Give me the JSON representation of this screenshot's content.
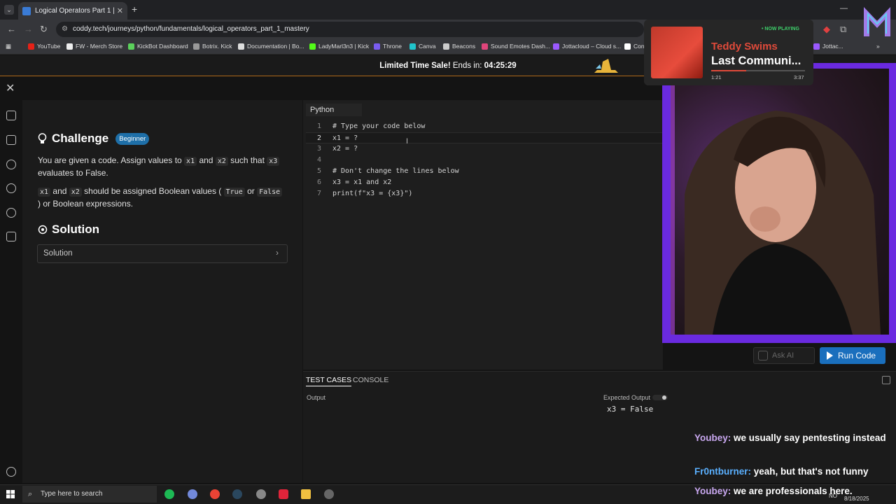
{
  "browser": {
    "tab_title": "Logical Operators Part 1 | Pytho",
    "url": "coddy.tech/journeys/python/fundamentals/logical_operators_part_1_mastery",
    "bookmarks": [
      "YouTube",
      "FW - Merch Store",
      "KickBot Dashboard",
      "Botrix. Kick",
      "Documentation | Bo...",
      "LadyMarl3n3 | Kick",
      "Throne",
      "Canva",
      "Beacons",
      "Sound Emotes Dash...",
      "Jottacloud – Cloud s...",
      "Con",
      "Jottac..."
    ]
  },
  "promo": {
    "text": "Limited Time Sale!",
    "ends_label": "Ends in:",
    "countdown": "04:25:29"
  },
  "challenge": {
    "title": "Challenge",
    "badge": "Beginner",
    "p1_a": "You are given a code. Assign values to",
    "p1_code1": "x1",
    "p1_and": "and",
    "p1_code2": "x2",
    "p1_b": "such that",
    "p1_code3": "x3",
    "p1_c": "evaluates to False.",
    "p2_code1": "x1",
    "p2_and": "and",
    "p2_code2": "x2",
    "p2_a": "should be assigned Boolean values (",
    "p2_true": "True",
    "p2_or": "or",
    "p2_false": "False",
    "p2_b": ") or Boolean expressions."
  },
  "solution": {
    "title": "Solution",
    "button": "Solution"
  },
  "editor": {
    "language": "Python",
    "lines": [
      {
        "num": "1",
        "code": "# Type your code below"
      },
      {
        "num": "2",
        "code": "x1 = ?"
      },
      {
        "num": "3",
        "code": "x2 = ?"
      },
      {
        "num": "4",
        "code": ""
      },
      {
        "num": "5",
        "code": "# Don't change the lines below"
      },
      {
        "num": "6",
        "code": "x3 = x1 and x2"
      },
      {
        "num": "7",
        "code": "print(f\"x3 = {x3}\")"
      }
    ]
  },
  "actions": {
    "ask_ai": "Ask AI",
    "run_code": "Run Code"
  },
  "bottom": {
    "tabs": [
      "TEST CASES",
      "CONSOLE"
    ],
    "output_label": "Output",
    "expected_label": "Expected Output",
    "expected_value": "x3 = False"
  },
  "now_playing": {
    "badge": "• NOW PLAYING",
    "artist": "Teddy Swims",
    "track": "Last Communi...",
    "elapsed": "1:21",
    "duration": "3:37",
    "progress_fraction": 0.37,
    "accent": "#e04a3a"
  },
  "chat": [
    {
      "user": "Youbey:",
      "msg": "we usually say pentesting instead"
    },
    {
      "user": "Fr0ntburner:",
      "msg": "yeah, but that's not funny"
    },
    {
      "user": "Youbey:",
      "msg": "we are professionals here."
    }
  ],
  "taskbar": {
    "search_placeholder": "Type here to search",
    "lang": "NO",
    "date": "8/18/2025"
  },
  "colors": {
    "accent": "#1a6fbd",
    "badge": "#1e6fa8",
    "cam_frame": "#6a2ae0"
  }
}
